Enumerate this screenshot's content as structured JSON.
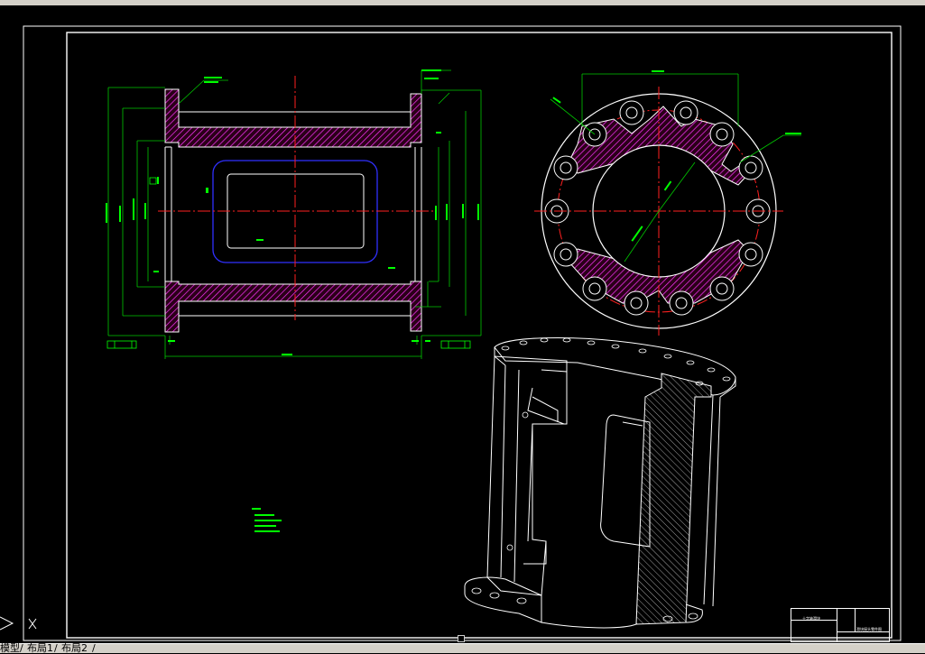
{
  "tabs": [
    {
      "label": "模型"
    },
    {
      "label": "布局1"
    },
    {
      "label": "布局2"
    }
  ],
  "tab_separator": "/",
  "title_block": {
    "title": "十字轴滑块",
    "part_name": "滑块接头零件图"
  },
  "colors": {
    "background": "#000000",
    "geometry": "#ffffff",
    "dimensions": "#00ff00",
    "centerlines": "#ff0000",
    "hatch": "#ff00ff",
    "hidden": "#2020ff",
    "ui_bar": "#d4d0c8"
  },
  "icons": {
    "ucs": "ucs-axis-icon",
    "tab_nav": "tab-nav-arrows-icon"
  }
}
